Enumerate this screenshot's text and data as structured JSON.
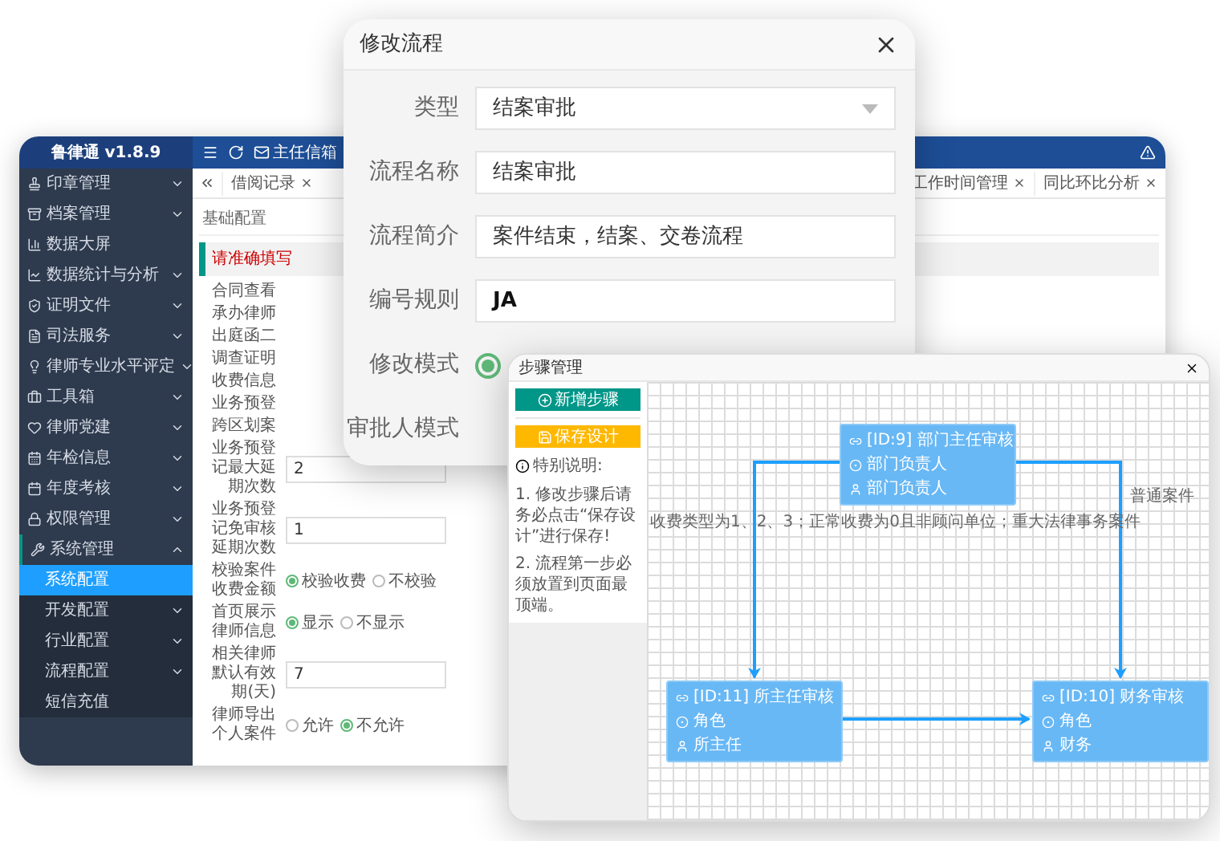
{
  "app": {
    "title": "鲁律通 v1.8.9",
    "mailbox": "主任信箱"
  },
  "sidebar": {
    "items": [
      {
        "label": "印章管理",
        "kind": "group",
        "expanded": false,
        "selected": false
      },
      {
        "label": "档案管理",
        "kind": "group",
        "expanded": false,
        "selected": false
      },
      {
        "label": "数据大屏",
        "kind": "page",
        "selected": false
      },
      {
        "label": "数据统计与分析",
        "kind": "group",
        "expanded": false,
        "selected": false
      },
      {
        "label": "证明文件",
        "kind": "group",
        "expanded": false,
        "selected": false
      },
      {
        "label": "司法服务",
        "kind": "group",
        "expanded": false,
        "selected": false
      },
      {
        "label": "律师专业水平评定",
        "kind": "group",
        "expanded": false,
        "selected": false
      },
      {
        "label": "工具箱",
        "kind": "group",
        "expanded": false,
        "selected": false
      },
      {
        "label": "律师党建",
        "kind": "group",
        "expanded": false,
        "selected": false
      },
      {
        "label": "年检信息",
        "kind": "group",
        "expanded": false,
        "selected": false
      },
      {
        "label": "年度考核",
        "kind": "group",
        "expanded": false,
        "selected": false
      },
      {
        "label": "权限管理",
        "kind": "group",
        "expanded": false,
        "selected": false
      },
      {
        "label": "系统管理",
        "kind": "group",
        "expanded": true,
        "selected": false,
        "children": [
          {
            "label": "系统配置",
            "kind": "page",
            "selected": true
          },
          {
            "label": "开发配置",
            "kind": "group",
            "expanded": false,
            "selected": false
          },
          {
            "label": "行业配置",
            "kind": "group",
            "expanded": false,
            "selected": false
          },
          {
            "label": "流程配置",
            "kind": "group",
            "expanded": false,
            "selected": false
          },
          {
            "label": "短信充值",
            "kind": "page",
            "selected": false
          }
        ]
      }
    ]
  },
  "page_tabs": {
    "left": [
      {
        "label": "借阅记录"
      }
    ],
    "right": [
      {
        "label": "工作时间管理"
      },
      {
        "label": "同比环比分析"
      }
    ]
  },
  "config_tabs": [
    {
      "label": "基础配置",
      "selected": false
    }
  ],
  "alert": "请准确填写",
  "config_rows": [
    {
      "kind": "label",
      "label": "合同查看"
    },
    {
      "kind": "label",
      "label": "承办律师"
    },
    {
      "kind": "label",
      "label": "出庭函二"
    },
    {
      "kind": "label",
      "label": "调查证明"
    },
    {
      "kind": "label",
      "label": "收费信息"
    },
    {
      "kind": "label",
      "label": "业务预登"
    },
    {
      "kind": "label",
      "label": "跨区划案"
    },
    {
      "kind": "input",
      "label": "业务预登记最大延期次数",
      "value": "2"
    },
    {
      "kind": "input",
      "label": "业务预登记免审核延期次数",
      "value": "1"
    },
    {
      "kind": "radio",
      "label": "校验案件收费金额",
      "options": [
        {
          "label": "校验收费",
          "selected": true
        },
        {
          "label": "不校验",
          "selected": false
        }
      ]
    },
    {
      "kind": "radio",
      "label": "首页展示律师信息",
      "options": [
        {
          "label": "显示",
          "selected": true
        },
        {
          "label": "不显示",
          "selected": false
        }
      ]
    },
    {
      "kind": "input",
      "label": "相关律师默认有效期(天)",
      "value": "7"
    },
    {
      "kind": "radio",
      "label": "律师导出个人案件",
      "options": [
        {
          "label": "允许",
          "selected": false
        },
        {
          "label": "不允许",
          "selected": true
        }
      ]
    }
  ],
  "modal": {
    "title": "修改流程",
    "fields": [
      {
        "kind": "select",
        "label": "类型",
        "value": "结案审批",
        "emphasis": false
      },
      {
        "kind": "input",
        "label": "流程名称",
        "value": "结案审批",
        "emphasis": false
      },
      {
        "kind": "input",
        "label": "流程简介",
        "value": "案件结束，结案、交卷流程",
        "emphasis": false
      },
      {
        "kind": "input",
        "label": "编号规则",
        "value": "JA",
        "emphasis": true
      },
      {
        "kind": "radio",
        "label": "修改模式",
        "options": [
          {
            "selected": true
          }
        ]
      },
      {
        "kind": "label",
        "label": "审批人模式"
      }
    ]
  },
  "steps": {
    "title": "步骤管理",
    "add_button": "新增步骤",
    "save_button": "保存设计",
    "note_title": "特别说明:",
    "notes": [
      "1. 修改步骤后请务必点击“保存设计”进行保存!",
      "2. 流程第一步必须放置到页面最顶端。"
    ],
    "nodes": [
      {
        "title": "[ID:9] 部门主任审核",
        "type": "部门负责人",
        "assignee": "部门负责人"
      },
      {
        "title": "[ID:11] 所主任审核",
        "type": "角色",
        "assignee": "所主任"
      },
      {
        "title": "[ID:10] 财务审核",
        "type": "角色",
        "assignee": "财务"
      }
    ],
    "edge_labels": [
      "收费类型为1、2、3；正常收费为0且非顾问单位；重大法律事务案件",
      "普通案件"
    ]
  }
}
